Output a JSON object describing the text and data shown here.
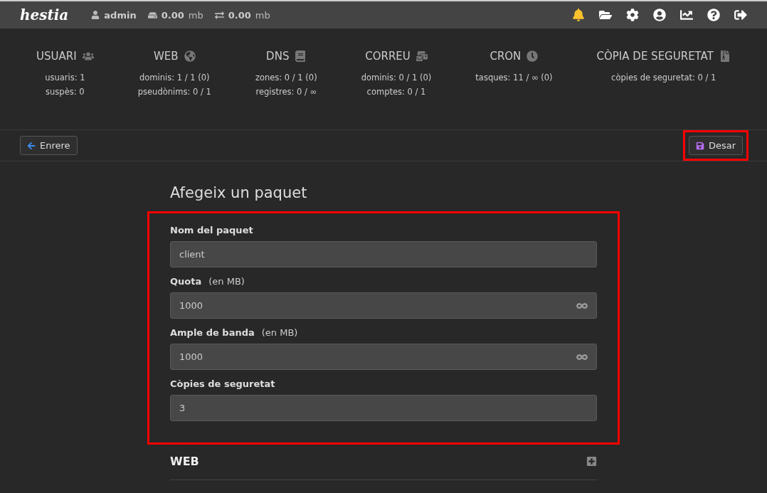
{
  "topbar": {
    "logo": "hestia",
    "user": "admin",
    "disk": {
      "value": "0.00",
      "unit": "mb"
    },
    "bandwidth": {
      "value": "0.00",
      "unit": "mb"
    },
    "icons": [
      {
        "kind": "bell",
        "alert": true
      },
      {
        "kind": "folder",
        "alert": false
      },
      {
        "kind": "settings",
        "alert": false
      },
      {
        "kind": "account",
        "alert": false
      },
      {
        "kind": "stats",
        "alert": false
      },
      {
        "kind": "help",
        "alert": false
      },
      {
        "kind": "logout",
        "alert": false
      }
    ]
  },
  "stats": [
    {
      "title": "USUARI",
      "kind": "users",
      "lines": [
        "usuaris: 1",
        "suspès: 0"
      ]
    },
    {
      "title": "WEB",
      "kind": "web",
      "lines": [
        "dominis: 1 / 1 (0)",
        "pseudònims: 0 / 1"
      ]
    },
    {
      "title": "DNS",
      "kind": "dns",
      "lines": [
        "zones: 0 / 1 (0)",
        "registres: 0 / ∞"
      ]
    },
    {
      "title": "CORREU",
      "kind": "mail",
      "lines": [
        "dominis: 0 / 1 (0)",
        "comptes: 0 / 1"
      ]
    },
    {
      "title": "CRON",
      "kind": "cron",
      "lines": [
        "tasques: 11 / ∞ (0)"
      ]
    },
    {
      "title": "CÒPIA DE SEGURETAT",
      "kind": "backup",
      "lines": [
        "còpies de seguretat: 0 / 1"
      ]
    }
  ],
  "toolbar": {
    "back": "Enrere",
    "save": "Desar",
    "save_highlighted": true
  },
  "form": {
    "title": "Afegeix un paquet",
    "highlighted": true,
    "fields": [
      {
        "label": "Nom del paquet",
        "value": "client",
        "unlimited": false
      },
      {
        "label": "Quota",
        "unit": "(en MB)",
        "value": "1000",
        "unlimited": true
      },
      {
        "label": "Ample de banda",
        "unit": "(en MB)",
        "value": "1000",
        "unlimited": true
      },
      {
        "label": "Còpies de seguretat",
        "value": "3",
        "unlimited": false
      }
    ],
    "sections": [
      {
        "title": "WEB",
        "expanded": false
      }
    ]
  }
}
